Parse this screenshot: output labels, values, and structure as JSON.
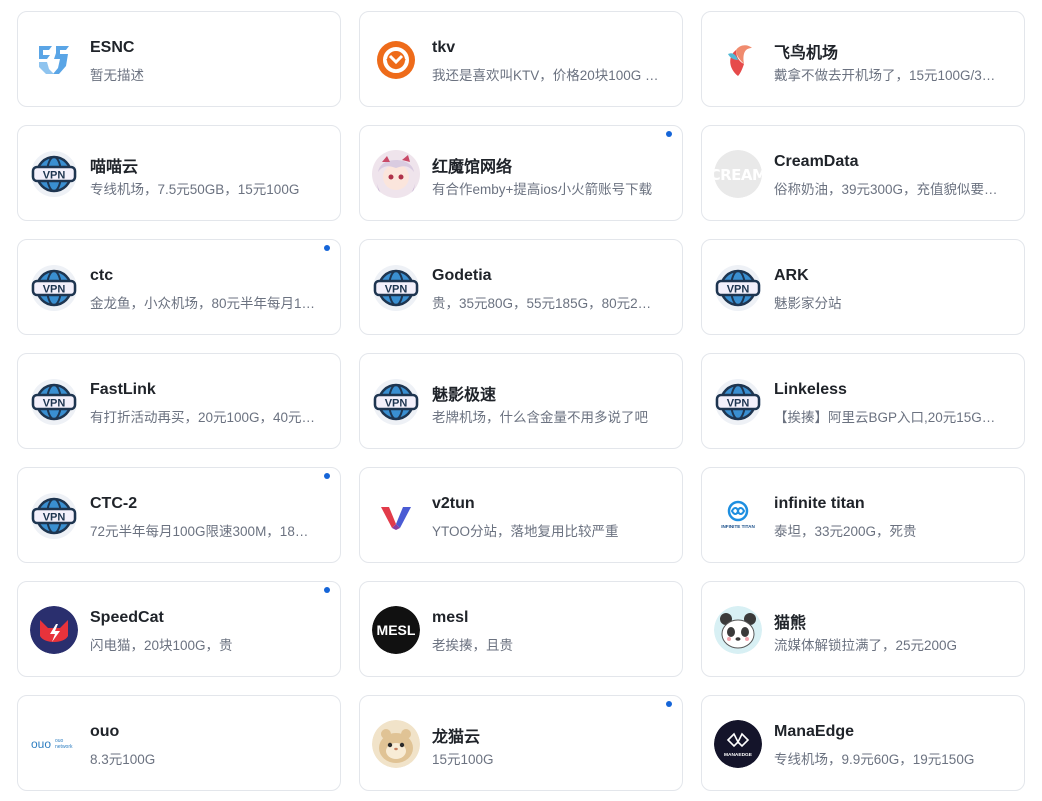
{
  "accent_color": "#1565d8",
  "cards": [
    {
      "title": "ESNC",
      "desc": "暂无描述",
      "icon": "esnc-logo-icon",
      "dot": false
    },
    {
      "title": "tkv",
      "desc": "我还是喜欢叫KTV，价格20块100G …",
      "icon": "tkv-logo-icon",
      "dot": false
    },
    {
      "title": "飞鸟机场",
      "desc": "戴拿不做去开机场了，15元100G/3…",
      "icon": "bird-logo-icon",
      "dot": false
    },
    {
      "title": "喵喵云",
      "desc": "专线机场，7.5元50GB，15元100G",
      "icon": "vpn-globe-icon",
      "dot": false
    },
    {
      "title": "红魔馆网络",
      "desc": "有合作emby+提高ios小火箭账号下载",
      "icon": "anime-avatar-icon",
      "dot": true
    },
    {
      "title": "CreamData",
      "desc": "俗称奶油，39元300G，充值貌似要…",
      "icon": "cream-logo-icon",
      "dot": false
    },
    {
      "title": "ctc",
      "desc": "金龙鱼，小众机场，80元半年每月1…",
      "icon": "vpn-globe-icon",
      "dot": true
    },
    {
      "title": "Godetia",
      "desc": "贵，35元80G，55元185G，80元2…",
      "icon": "vpn-globe-icon",
      "dot": false
    },
    {
      "title": "ARK",
      "desc": "魅影家分站",
      "icon": "vpn-globe-icon",
      "dot": false
    },
    {
      "title": "FastLink",
      "desc": "有打折活动再买，20元100G，40元…",
      "icon": "vpn-globe-icon",
      "dot": false
    },
    {
      "title": "魅影极速",
      "desc": "老牌机场，什么含金量不用多说了吧",
      "icon": "vpn-globe-icon",
      "dot": false
    },
    {
      "title": "Linkeless",
      "desc": "【挨揍】阿里云BGP入口,20元15G…",
      "icon": "vpn-globe-icon",
      "dot": false
    },
    {
      "title": "CTC-2",
      "desc": "72元半年每月100G限速300M，18…",
      "icon": "vpn-globe-icon",
      "dot": true
    },
    {
      "title": "v2tun",
      "desc": "YTOO分站，落地复用比较严重",
      "icon": "v2tun-logo-icon",
      "dot": false
    },
    {
      "title": "infinite titan",
      "desc": "泰坦，33元200G，死贵",
      "icon": "infinite-titan-logo-icon",
      "dot": false
    },
    {
      "title": "SpeedCat",
      "desc": "闪电猫，20块100G，贵",
      "icon": "speedcat-logo-icon",
      "dot": true
    },
    {
      "title": "mesl",
      "desc": "老挨揍，且贵",
      "icon": "mesl-logo-icon",
      "dot": false
    },
    {
      "title": "猫熊",
      "desc": "流媒体解锁拉满了，25元200G",
      "icon": "panda-logo-icon",
      "dot": false
    },
    {
      "title": "ouo",
      "desc": "8.3元100G",
      "icon": "ouo-logo-icon",
      "dot": false
    },
    {
      "title": "龙猫云",
      "desc": "15元100G",
      "icon": "hamster-logo-icon",
      "dot": true
    },
    {
      "title": "ManaEdge",
      "desc": "专线机场，9.9元60G，19元150G",
      "icon": "manaedge-logo-icon",
      "dot": false
    }
  ],
  "logo_text": {
    "cream": "CREAM",
    "mesl": "MESL",
    "titan": "INFINITE TITAN",
    "ouo": "ouo",
    "ouo_sub": "ouo network",
    "manaedge": "MANAEDGE"
  }
}
